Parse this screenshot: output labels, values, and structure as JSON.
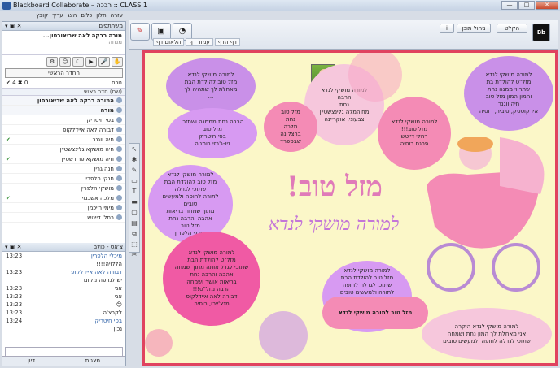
{
  "window": {
    "title": "Blackboard Collaborate – רבכה :: CLASS 1",
    "min": "—",
    "max": "□",
    "close": "✕"
  },
  "menu": [
    "עזרה",
    "חלון",
    "כלים",
    "הצג",
    "עריך",
    "קובץ"
  ],
  "participants_panel": {
    "title": "משתתפים",
    "moderator_name": "מורה רבקה לאה שביאורסון...",
    "moderator_sub": "מנחה",
    "status_select": "החדר הראשי",
    "count_left": "✔ 4  ✖ 0",
    "count_right": "נוכח",
    "list_header": "(שם) חדר ראשי",
    "rows": [
      {
        "name": "המורה רבקה לאה שביאורסון",
        "group": true,
        "status": ""
      },
      {
        "name": "מורה",
        "group": true,
        "status": ""
      },
      {
        "name": "בסי חיטריק",
        "group": false,
        "status": ""
      },
      {
        "name": "דבורה לאה איידלקופ",
        "group": false,
        "status": ""
      },
      {
        "name": "חיה ווגנר",
        "group": false,
        "status": "✔"
      },
      {
        "name": "חיה מושקא גלינצשטיין",
        "group": false,
        "status": ""
      },
      {
        "name": "חיה מושקא פרידשטיין",
        "group": false,
        "status": "✔"
      },
      {
        "name": "חנה גרין",
        "group": false,
        "status": ""
      },
      {
        "name": "חנקי הלפרין",
        "group": false,
        "status": ""
      },
      {
        "name": "מושקי הלפרין",
        "group": false,
        "status": ""
      },
      {
        "name": "מלכה אשכנזי",
        "group": false,
        "status": "✔"
      },
      {
        "name": "מימי רייכמן",
        "group": false,
        "status": ""
      },
      {
        "name": "רחלי דייטש",
        "group": false,
        "status": ""
      }
    ]
  },
  "chat_panel": {
    "title": "צ'אט - כולם",
    "rows": [
      {
        "time": "13:23",
        "msg": "מיכלי הלפרין",
        "author": true
      },
      {
        "time": "",
        "msg": "הללויה!!!!",
        "author": false
      },
      {
        "time": "13:23",
        "msg": "דבורה לאה איידלקופ",
        "author": true
      },
      {
        "time": "",
        "msg": "יש לנו פה מקום",
        "author": false
      },
      {
        "time": "13:23",
        "msg": "אני",
        "author": false
      },
      {
        "time": "13:23",
        "msg": "אני",
        "author": false
      },
      {
        "time": "13:23",
        "msg": "😊",
        "author": false
      },
      {
        "time": "13:23",
        "msg": "לקרצ'ה",
        "author": false
      },
      {
        "time": "13:24",
        "msg": "בסי חיטריק",
        "author": true
      },
      {
        "time": "",
        "msg": "נכון",
        "author": false
      }
    ],
    "tab_left": "דיון",
    "tab_right": "מצגות"
  },
  "toolbar": {
    "nav_tabs": [
      "דף הדף",
      "עמוד דף",
      "הלאום דף"
    ],
    "btn_refresh": "הקלט",
    "btn_info": "ניהול תוכן",
    "logo": "Bb"
  },
  "board": {
    "title": "מזל טוב!",
    "subtitle": "למורה מושקי לנדא",
    "bubbles": [
      {
        "id": "b1",
        "text": "למורה מושקי לנדא\nמזל טוב להולדת הבת\nמאחלת לך שתהיה לך\n..."
      },
      {
        "id": "b2",
        "text": "למורה מושקי לנדא\nהרבה\nנחת\nמחיהמלה גלינצשטיין\nצבעוני, אוקריינה"
      },
      {
        "id": "b3",
        "text": "למורה מושקי לנדא\nמזל\"ט להולדת בת\nשתרווי ממנה נחת\nוהמון המון מזל טוב\nחיה ווגנר\nאירקוטסק, סיביר, רוסיה"
      },
      {
        "id": "b4",
        "text": "הרבה נחת מממנה ושתזכי\nמזל טוב\nבסי חיטריק\nניו-ג'רזי בומניה"
      },
      {
        "id": "b5",
        "text": "מזל טוב\nנחת\nמלכה\nברצלונה שבספרד"
      },
      {
        "id": "b6",
        "text": "למורה מושקי לנדא\nמזל טוב!!!\nרחלי דייטש\nפרגם רוסיה"
      },
      {
        "id": "b7",
        "text": "למורה מושקי לנדא\nמזל טוב להולדת הבת\nשתזכי לגדלה\nלתורה לחופה ולמעשים\nטובים\nמתוך שמחה בריאות\nאהבה והרבה נחת\nמזל טוב\nמיכלי הלפרין"
      },
      {
        "id": "b8",
        "text": "למורה מושקי לנדא\nמזל\"ט להולדת הבת\nשתזכי לגדל אותה מתוך שמחה\nאהבה והרבה נחת\nבריאות אושר ושמחה\nהרבה מזל\"ט!!!\nדבורה לאה איידלקופ\nמנצ'יירו, רוסיה"
      },
      {
        "id": "b9",
        "text": "למורה מושקי לנדא\nמזל טוב להולדת הבת\nשתזכי לגדלה לחופה\nלתורה ולמעשים טובים\nבשמחה\nבריאות אושר ושמחה\nרבה מזל טוב!!!\nמיכלי הלפרין"
      },
      {
        "id": "b10",
        "text": "מזל טוב למורה מושקי לנדא"
      },
      {
        "id": "b11",
        "text": "למורה מושקי לנדא היקרה\nאני מאחלת לך המון נחת ושמחה\nשתזכי לגדלה לחופה ולמעשים טובים"
      }
    ]
  },
  "whiteboard_tools": [
    "↖",
    "✱",
    "✎",
    "▭",
    "T",
    "▬",
    "▢",
    "▤",
    "⧉",
    "⬚",
    "✂"
  ]
}
